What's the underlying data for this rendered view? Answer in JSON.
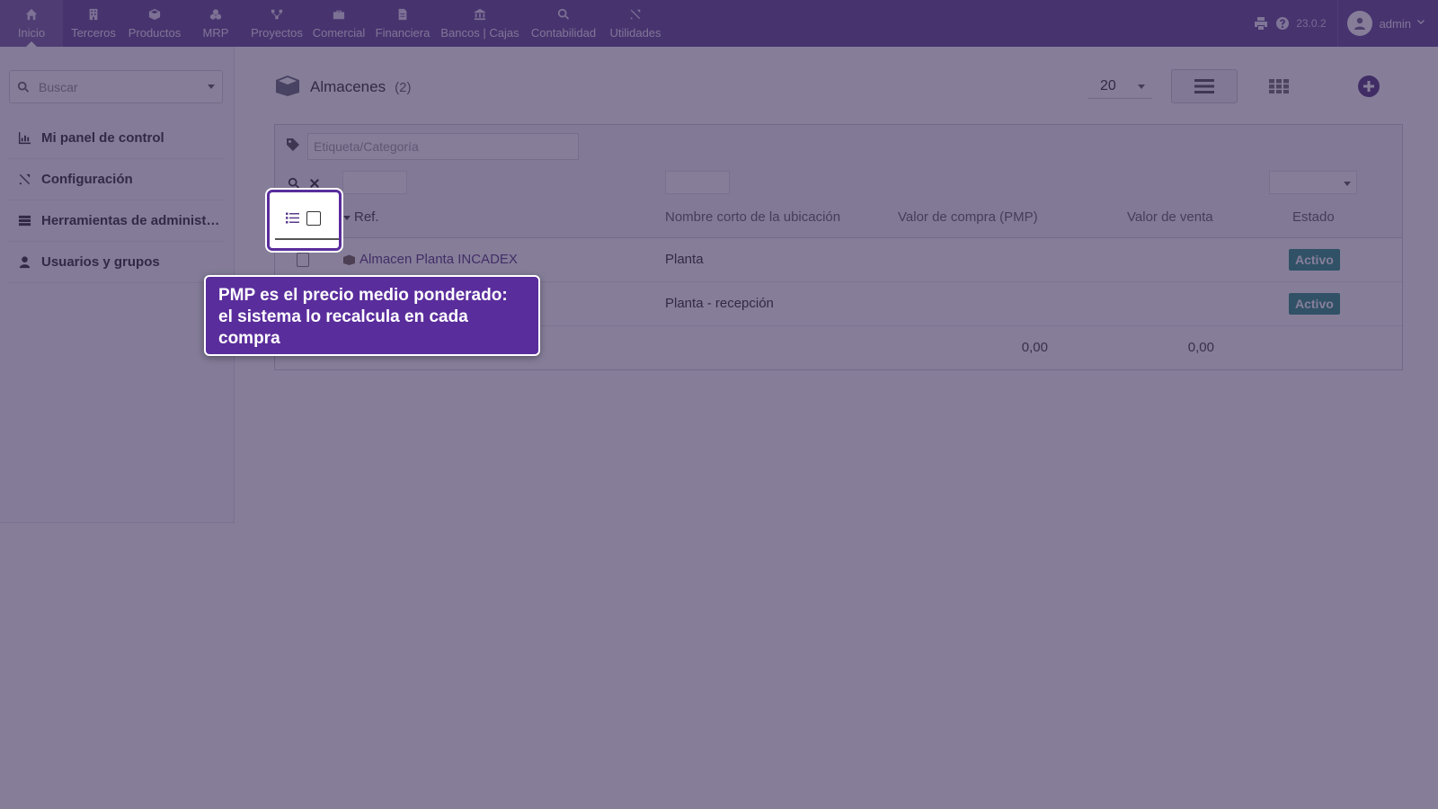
{
  "nav": {
    "items": [
      {
        "label": "Inicio",
        "icon": "home-icon"
      },
      {
        "label": "Terceros",
        "icon": "building-icon"
      },
      {
        "label": "Productos",
        "icon": "cube-icon"
      },
      {
        "label": "MRP",
        "icon": "cubes-icon"
      },
      {
        "label": "Proyectos",
        "icon": "sitemap-icon"
      },
      {
        "label": "Comercial",
        "icon": "briefcase-icon"
      },
      {
        "label": "Financiera",
        "icon": "file-invoice-icon"
      },
      {
        "label": "Bancos | Cajas",
        "icon": "bank-icon"
      },
      {
        "label": "Contabilidad",
        "icon": "search-dollar-icon"
      },
      {
        "label": "Utilidades",
        "icon": "tools-icon"
      }
    ],
    "active": "Inicio",
    "version": "23.0.2",
    "user": "admin"
  },
  "sidebar": {
    "search_placeholder": "Buscar",
    "items": [
      {
        "label": "Mi panel de control",
        "icon": "chart-icon"
      },
      {
        "label": "Configuración",
        "icon": "tools-icon"
      },
      {
        "label": "Herramientas de administración",
        "icon": "server-icon"
      },
      {
        "label": "Usuarios y grupos",
        "icon": "user-icon"
      }
    ]
  },
  "page": {
    "title": "Almacenes",
    "count": "(2)",
    "limit": "20"
  },
  "filters": {
    "tag_placeholder": "Etiqueta/Categoría"
  },
  "table": {
    "headers": {
      "ref": "Ref.",
      "location": "Nombre corto de la ubicación",
      "pmp": "Valor de compra (PMP)",
      "sale": "Valor de venta",
      "status": "Estado"
    },
    "rows": [
      {
        "ref": "Almacen Planta INCADEX",
        "location": "Planta",
        "status": "Activo"
      },
      {
        "ref": "",
        "location": "Planta - recepción",
        "status": "Activo"
      }
    ],
    "totals": {
      "pmp": "0,00",
      "sale": "0,00"
    }
  },
  "tooltip": {
    "text": "PMP es el precio medio ponderado: el sistema lo recalcula en cada compra"
  },
  "colors": {
    "topbar": "#5a3a8e",
    "tooltip": "#5a2d9c",
    "badge": "#1f8a7a",
    "overlay": "#3c2e5a"
  }
}
